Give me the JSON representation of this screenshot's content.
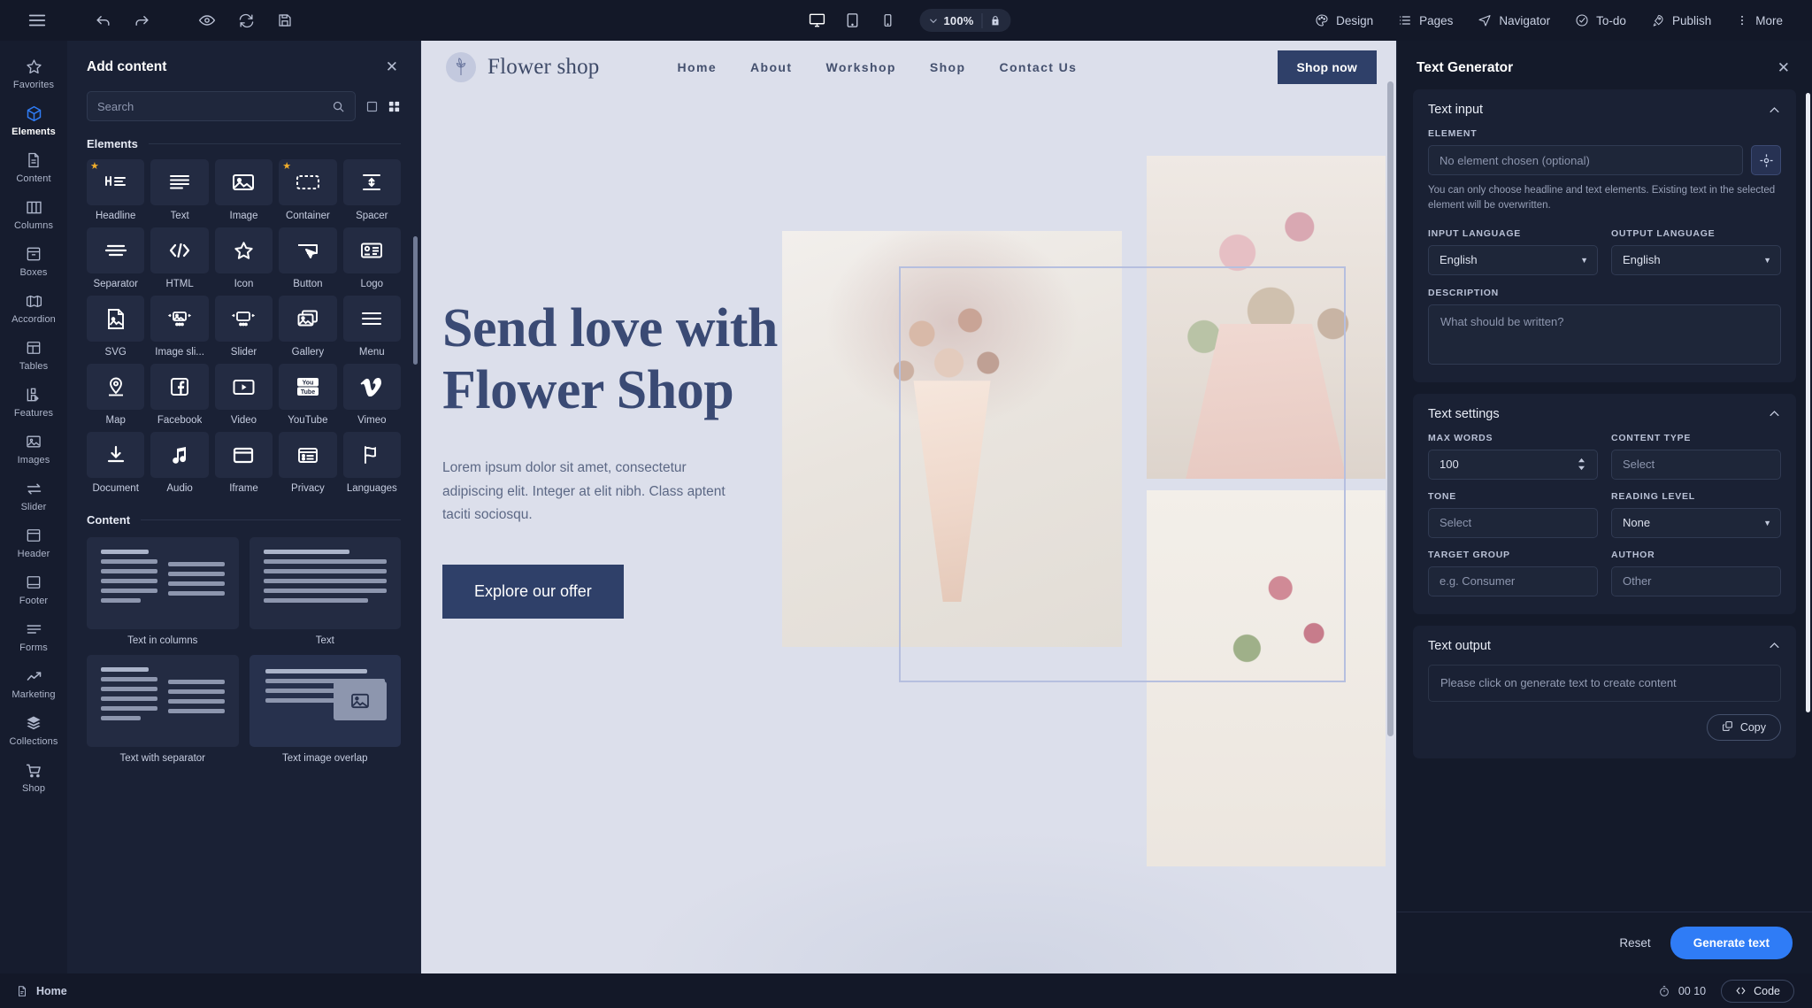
{
  "topbar": {
    "menu_icon": "hamburger-icon",
    "undo_icon": "undo-arrow-icon",
    "redo_icon": "redo-arrow-icon",
    "preview_icon": "eye-icon",
    "refresh_icon": "refresh-icon",
    "save_icon": "save-disk-icon",
    "devices": [
      {
        "name": "desktop",
        "icon": "desktop-monitor-icon",
        "active": true
      },
      {
        "name": "tablet",
        "icon": "tablet-icon",
        "active": false
      },
      {
        "name": "mobile",
        "icon": "mobile-phone-icon",
        "active": false
      }
    ],
    "zoom_value": "100%",
    "lock_icon": "lock-icon",
    "right_items": [
      {
        "label": "Design",
        "icon": "palette-icon"
      },
      {
        "label": "Pages",
        "icon": "list-icon"
      },
      {
        "label": "Navigator",
        "icon": "navigation-arrow-icon"
      },
      {
        "label": "To-do",
        "icon": "check-circle-icon"
      },
      {
        "label": "Publish",
        "icon": "rocket-icon"
      },
      {
        "label": "More",
        "icon": "vertical-dots-icon"
      }
    ]
  },
  "rail": {
    "items": [
      {
        "label": "Favorites",
        "icon": "star-icon",
        "active": false
      },
      {
        "label": "Elements",
        "icon": "cube-icon",
        "active": true
      },
      {
        "label": "Content",
        "icon": "document-icon",
        "active": false
      },
      {
        "label": "Columns",
        "icon": "columns-icon",
        "active": false
      },
      {
        "label": "Boxes",
        "icon": "box-icon",
        "active": false
      },
      {
        "label": "Accordion",
        "icon": "accordion-icon",
        "active": false
      },
      {
        "label": "Tables",
        "icon": "table-icon",
        "active": false
      },
      {
        "label": "Features",
        "icon": "features-icon",
        "active": false
      },
      {
        "label": "Images",
        "icon": "image-icon",
        "active": false
      },
      {
        "label": "Slider",
        "icon": "slider-arrows-icon",
        "active": false
      },
      {
        "label": "Header",
        "icon": "header-icon",
        "active": false
      },
      {
        "label": "Footer",
        "icon": "footer-icon",
        "active": false
      },
      {
        "label": "Forms",
        "icon": "forms-icon",
        "active": false
      },
      {
        "label": "Marketing",
        "icon": "trend-up-icon",
        "active": false
      },
      {
        "label": "Collections",
        "icon": "layers-icon",
        "active": false
      },
      {
        "label": "Shop",
        "icon": "shopping-cart-icon",
        "active": false
      }
    ]
  },
  "add_content": {
    "title": "Add content",
    "close_icon": "close-icon",
    "search_placeholder": "Search",
    "search_value": "",
    "search_icon": "search-icon",
    "view_list_icon": "square-view-icon",
    "view_grid_icon": "grid-view-icon",
    "sections": [
      {
        "title": "Elements",
        "items": [
          {
            "label": "Headline",
            "icon": "headline-icon",
            "starred": true
          },
          {
            "label": "Text",
            "icon": "text-lines-icon",
            "starred": false
          },
          {
            "label": "Image",
            "icon": "image-frame-icon",
            "starred": false
          },
          {
            "label": "Container",
            "icon": "container-icon",
            "starred": true
          },
          {
            "label": "Spacer",
            "icon": "spacer-icon",
            "starred": false
          },
          {
            "label": "Separator",
            "icon": "separator-icon",
            "starred": false
          },
          {
            "label": "HTML",
            "icon": "code-brackets-icon",
            "starred": false
          },
          {
            "label": "Icon",
            "icon": "star-outline-icon",
            "starred": false
          },
          {
            "label": "Button",
            "icon": "button-icon",
            "starred": false
          },
          {
            "label": "Logo",
            "icon": "logo-card-icon",
            "starred": false
          },
          {
            "label": "SVG",
            "icon": "svg-file-icon",
            "starred": false
          },
          {
            "label": "Image sli...",
            "icon": "image-slider-icon",
            "starred": false
          },
          {
            "label": "Slider",
            "icon": "slider-box-icon",
            "starred": false
          },
          {
            "label": "Gallery",
            "icon": "gallery-icon",
            "starred": false
          },
          {
            "label": "Menu",
            "icon": "menu-lines-icon",
            "starred": false
          },
          {
            "label": "Map",
            "icon": "map-pin-icon",
            "starred": false
          },
          {
            "label": "Facebook",
            "icon": "facebook-icon",
            "starred": false
          },
          {
            "label": "Video",
            "icon": "video-play-icon",
            "starred": false
          },
          {
            "label": "YouTube",
            "icon": "youtube-icon",
            "starred": false
          },
          {
            "label": "Vimeo",
            "icon": "vimeo-icon",
            "starred": false
          },
          {
            "label": "Document",
            "icon": "download-document-icon",
            "starred": false
          },
          {
            "label": "Audio",
            "icon": "music-note-icon",
            "starred": false
          },
          {
            "label": "Iframe",
            "icon": "iframe-window-icon",
            "starred": false
          },
          {
            "label": "Privacy",
            "icon": "privacy-list-icon",
            "starred": false
          },
          {
            "label": "Languages",
            "icon": "flag-icon",
            "starred": false
          }
        ]
      }
    ],
    "content_section_title": "Content",
    "content_items": [
      {
        "label": "Text in columns",
        "layout": "two-column-text"
      },
      {
        "label": "Text",
        "layout": "single-column-text"
      },
      {
        "label": "Text with separator",
        "layout": "text-with-separator"
      },
      {
        "label": "Text image overlap",
        "layout": "text-image-overlap"
      }
    ]
  },
  "site": {
    "brand": "Flower shop",
    "brand_logo_icon": "flower-logo-icon",
    "nav": [
      "Home",
      "About",
      "Workshop",
      "Shop",
      "Contact Us"
    ],
    "cta_button": "Shop now",
    "hero_heading_line1": "Send love with",
    "hero_heading_line2": "Flower Shop",
    "hero_paragraph": "Lorem ipsum dolor sit amet, consectetur adipiscing elit. Integer at elit nibh. Class aptent taciti sociosqu.",
    "hero_button": "Explore our offer",
    "accent_color": "#2f4069",
    "background_color": "#dcdfeb"
  },
  "text_generator": {
    "title": "Text Generator",
    "close_icon": "close-icon",
    "text_input": {
      "title": "Text input",
      "collapse_icon": "chevron-up-icon",
      "element_label": "ELEMENT",
      "element_placeholder": "No element chosen (optional)",
      "element_value": "",
      "picker_icon": "crosshair-target-icon",
      "hint": "You can only choose headline and text elements. Existing text in the selected element will be overwritten.",
      "input_language_label": "INPUT LANGUAGE",
      "input_language_value": "English",
      "output_language_label": "OUTPUT LANGUAGE",
      "output_language_value": "English",
      "description_label": "DESCRIPTION",
      "description_placeholder": "What should be written?",
      "description_value": ""
    },
    "text_settings": {
      "title": "Text settings",
      "collapse_icon": "chevron-up-icon",
      "max_words_label": "MAX WORDS",
      "max_words_value": "100",
      "content_type_label": "CONTENT TYPE",
      "content_type_value": "Select",
      "tone_label": "TONE",
      "tone_value": "Select",
      "reading_level_label": "READING LEVEL",
      "reading_level_value": "None",
      "target_group_label": "TARGET GROUP",
      "target_group_placeholder": "e.g. Consumer",
      "author_label": "AUTHOR",
      "author_placeholder": "Other"
    },
    "text_output": {
      "title": "Text output",
      "collapse_icon": "chevron-up-icon",
      "placeholder": "Please click on generate text to create content",
      "copy_label": "Copy",
      "copy_icon": "copy-icon"
    },
    "footer": {
      "reset_label": "Reset",
      "generate_label": "Generate text",
      "generate_color": "#2f7cf6"
    }
  },
  "statusbar": {
    "page_label": "Home",
    "page_icon": "page-document-icon",
    "timer_icon": "stopwatch-icon",
    "timer_value": "00 10",
    "code_label": "Code",
    "code_icon": "code-brackets-icon"
  }
}
